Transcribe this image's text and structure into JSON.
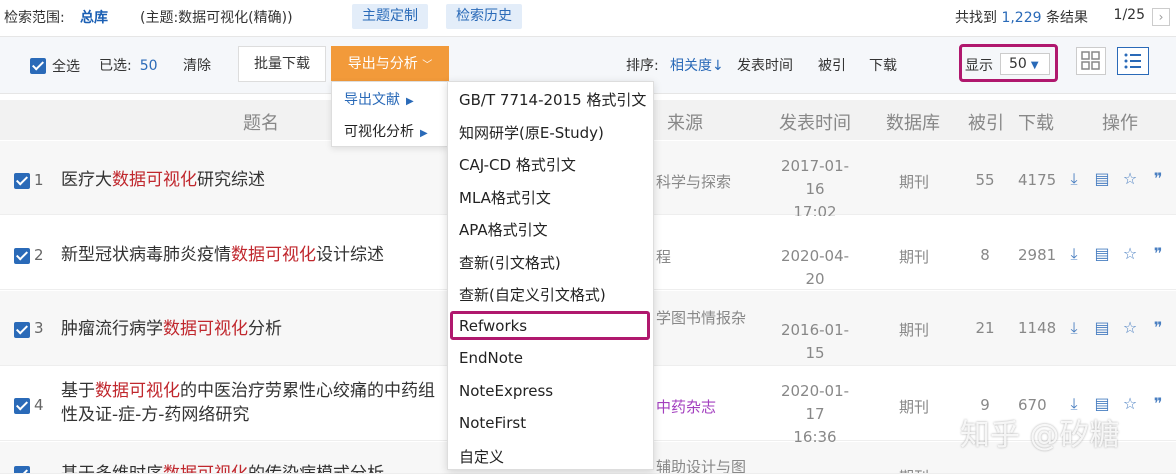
{
  "topbar": {
    "scope_label": "检索范围:",
    "scope_value": "总库",
    "subject": "(主题:数据可视化(精确))",
    "btn_topic": "主题定制",
    "btn_history": "检索历史",
    "found_prefix": "共找到",
    "found_count": "1,229",
    "found_suffix": "条结果",
    "page": "1/25",
    "next_icon": "chevron-right"
  },
  "toolbar": {
    "select_all": "全选",
    "selected_label": "已选:",
    "selected_count": "50",
    "clear": "清除",
    "batch_download": "批量下载",
    "export_analysis": "导出与分析",
    "sort_label": "排序:",
    "sort_relevance": "相关度",
    "sort_date": "发表时间",
    "sort_cited": "被引",
    "sort_download": "下载",
    "show_label": "显示",
    "show_value": "50"
  },
  "table": {
    "headers": [
      "题名",
      "来源",
      "发表时间",
      "数据库",
      "被引",
      "下载",
      "操作"
    ]
  },
  "rows": [
    {
      "num": "1",
      "title_pre": "医疗大",
      "title_hl": "数据可视化",
      "title_post": "研究综述",
      "title_line2": "",
      "source": "科学与探索",
      "date": "2017-01-16",
      "time": "17:02",
      "db": "期刊",
      "cited": "55",
      "downloads": "4175"
    },
    {
      "num": "2",
      "title_pre": "新型冠状病毒肺炎疫情",
      "title_hl": "数据可视化",
      "title_post": "设计综述",
      "title_line2": "",
      "source": "程",
      "date": "2020-04-20",
      "time": "",
      "db": "期刊",
      "cited": "8",
      "downloads": "2981"
    },
    {
      "num": "3",
      "title_pre": "肿瘤流行病学",
      "title_hl": "数据可视化",
      "title_post": "分析",
      "title_line2": "",
      "source": "学图书情报杂",
      "date": "2016-01-15",
      "time": "",
      "db": "期刊",
      "cited": "21",
      "downloads": "1148"
    },
    {
      "num": "4",
      "title_pre": "基于",
      "title_hl": "数据可视化",
      "title_post": "的中医治疗劳累性心绞痛的中药组",
      "title_line2": "性及证-症-方-药网络研究",
      "source": "中药杂志",
      "date": "2020-01-17",
      "time": "16:36",
      "db": "期刊",
      "cited": "9",
      "downloads": "670"
    },
    {
      "num": "5",
      "title_pre": "基于多维时序",
      "title_hl": "数据可视化",
      "title_post": "的传染病模式分析",
      "title_line2": "",
      "source": "辅助设计与图",
      "date": "",
      "time": "",
      "db": "期刊",
      "cited": "",
      "downloads": ""
    }
  ],
  "export_menu": {
    "items": [
      "导出文献",
      "可视化分析"
    ]
  },
  "citation_menu": {
    "items": [
      "GB/T 7714-2015 格式引文",
      "知网研学(原E-Study)",
      "CAJ-CD 格式引文",
      "MLA格式引文",
      "APA格式引文",
      "查新(引文格式)",
      "查新(自定义引文格式)",
      "Refworks",
      "EndNote",
      "NoteExpress",
      "NoteFirst",
      "自定义"
    ]
  },
  "watermark": "知乎 @矽糖",
  "colors": {
    "accent": "#2a6ab8",
    "highlight": "#c0272d",
    "export_button": "#f29a3a",
    "annotation": "#b0186e"
  }
}
